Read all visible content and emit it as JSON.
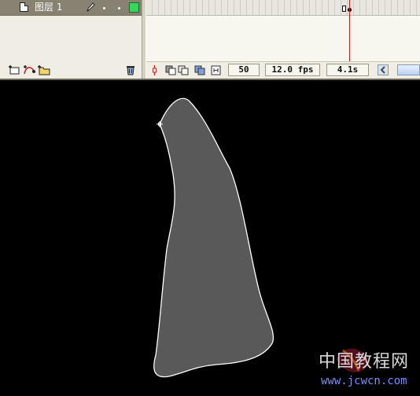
{
  "layer": {
    "name": "图层 1",
    "outline_color": "#35d85a"
  },
  "timeline": {
    "current_frame": "50",
    "frame_rate": "12.0 fps",
    "elapsed_time": "4.1s"
  },
  "icons": {
    "layer_icon": "layer-icon",
    "edit_icon": "pencil-icon",
    "insert_layer": "insert-layer-icon",
    "add_motion_guide": "add-motion-guide-icon",
    "insert_folder": "insert-folder-icon",
    "delete_layer": "trash-icon",
    "center_frame": "center-frame-icon",
    "onion_skin": "onion-skin-icon",
    "onion_skin_outlines": "onion-skin-outlines-icon",
    "edit_multiple_frames": "edit-multiple-frames-icon",
    "modify_onion_markers": "modify-onion-markers-icon",
    "scroll_left": "scroll-left-icon"
  },
  "colors": {
    "stage_background": "#000000",
    "shape_fill": "#595959",
    "shape_stroke": "#ffffff",
    "playhead": "#d21919"
  },
  "watermark": {
    "title": "中国教程网",
    "url": "www.jcwcn.com"
  }
}
